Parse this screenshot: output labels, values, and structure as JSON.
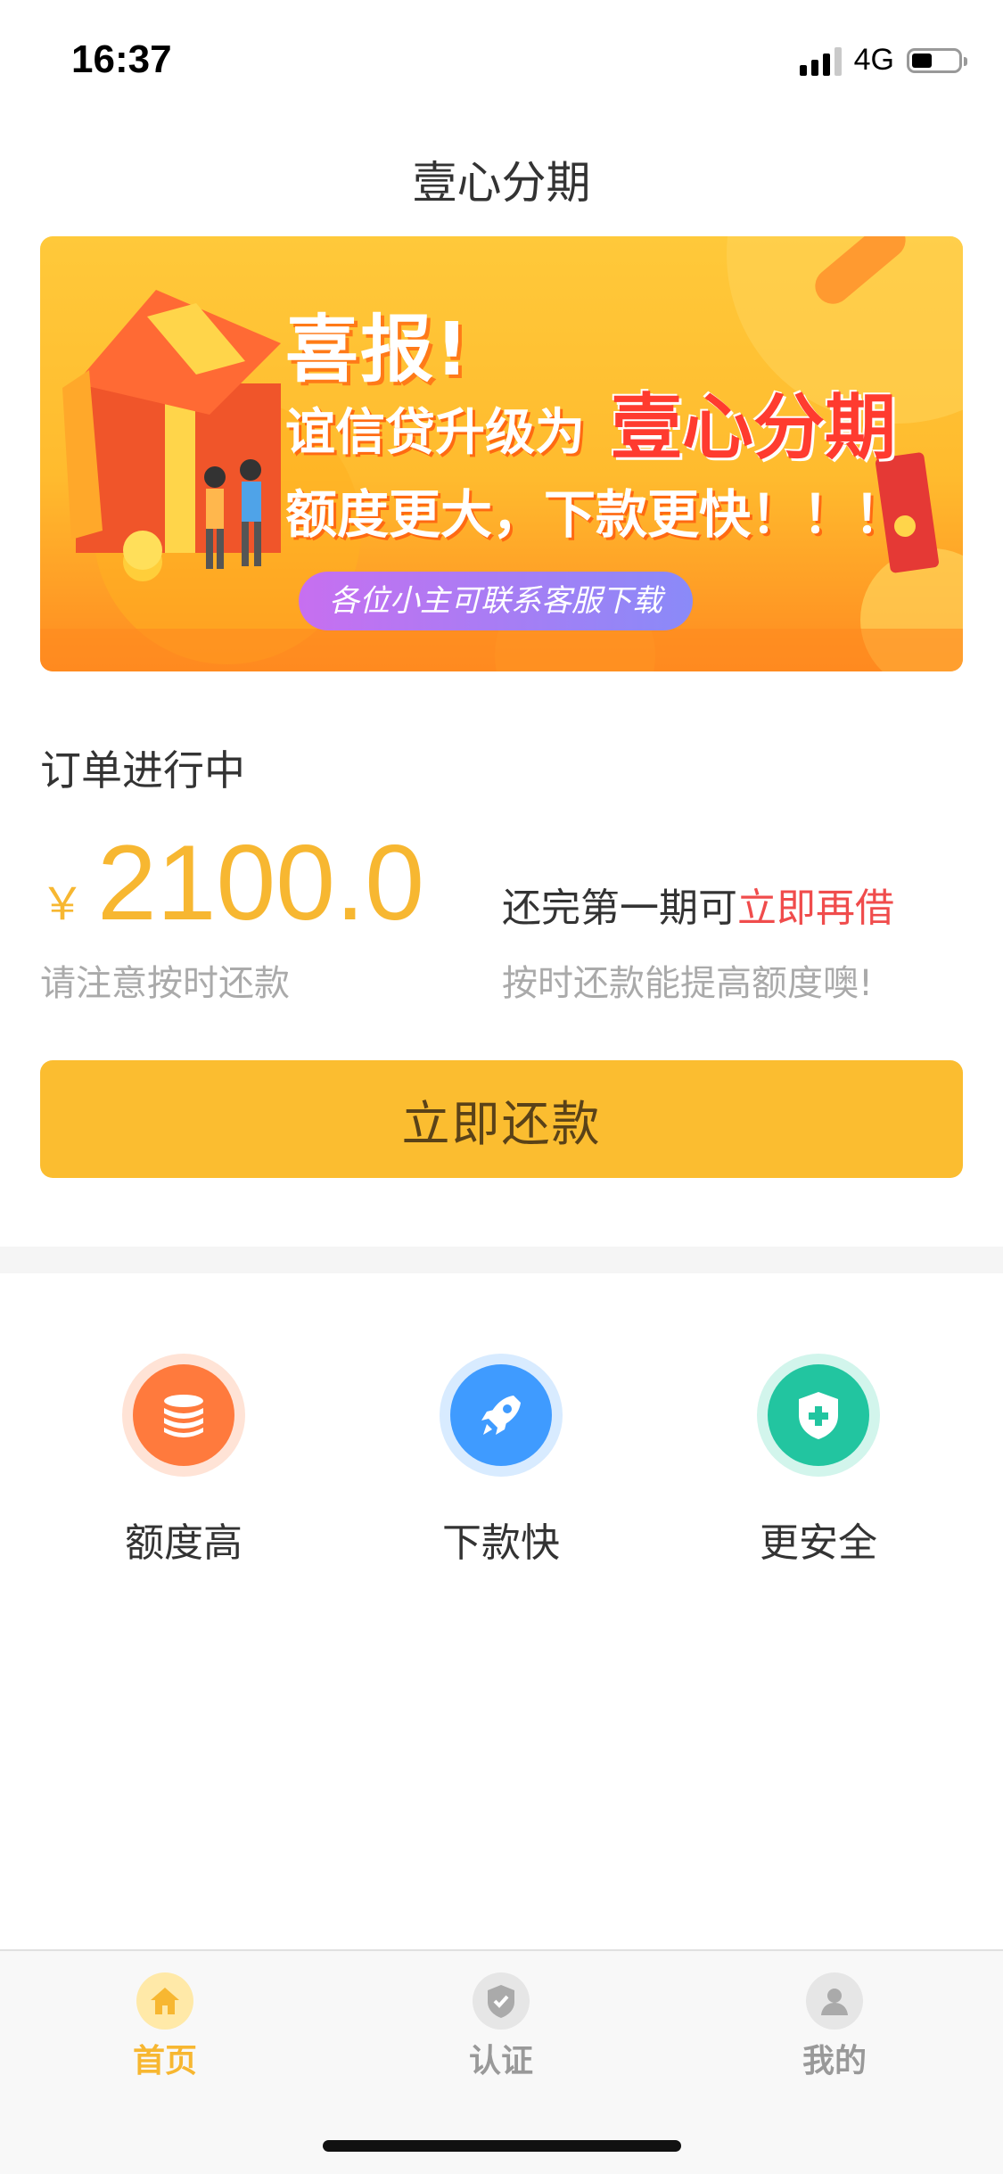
{
  "status_bar": {
    "time": "16:37",
    "network": "4G"
  },
  "nav": {
    "title": "壹心分期"
  },
  "banner": {
    "headline": "喜报!",
    "line1_prefix": "谊信贷升级为",
    "line1_brand": "壹心分期",
    "line2": "额度更大，下款更快！！！",
    "pill": "各位小主可联系客服下载"
  },
  "order": {
    "status_title": "订单进行中",
    "currency": "￥",
    "amount": "2100.0",
    "amount_note": "请注意按时还款",
    "promo_prefix": "还完第一期可",
    "promo_highlight": "立即再借",
    "promo_note": "按时还款能提高额度噢!"
  },
  "repay_button": {
    "label": "立即还款"
  },
  "features": [
    {
      "label": "额度高",
      "icon": "coin-stack-icon",
      "color": "#ff7a3d"
    },
    {
      "label": "下款快",
      "icon": "rocket-icon",
      "color": "#3f9bff"
    },
    {
      "label": "更安全",
      "icon": "shield-plus-icon",
      "color": "#22c5a0"
    }
  ],
  "tabbar": {
    "items": [
      {
        "label": "首页",
        "icon": "home-icon",
        "active": true
      },
      {
        "label": "认证",
        "icon": "shield-check-icon",
        "active": false
      },
      {
        "label": "我的",
        "icon": "user-icon",
        "active": false
      }
    ],
    "active_color": "#f7b731",
    "inactive_color": "#999999"
  }
}
